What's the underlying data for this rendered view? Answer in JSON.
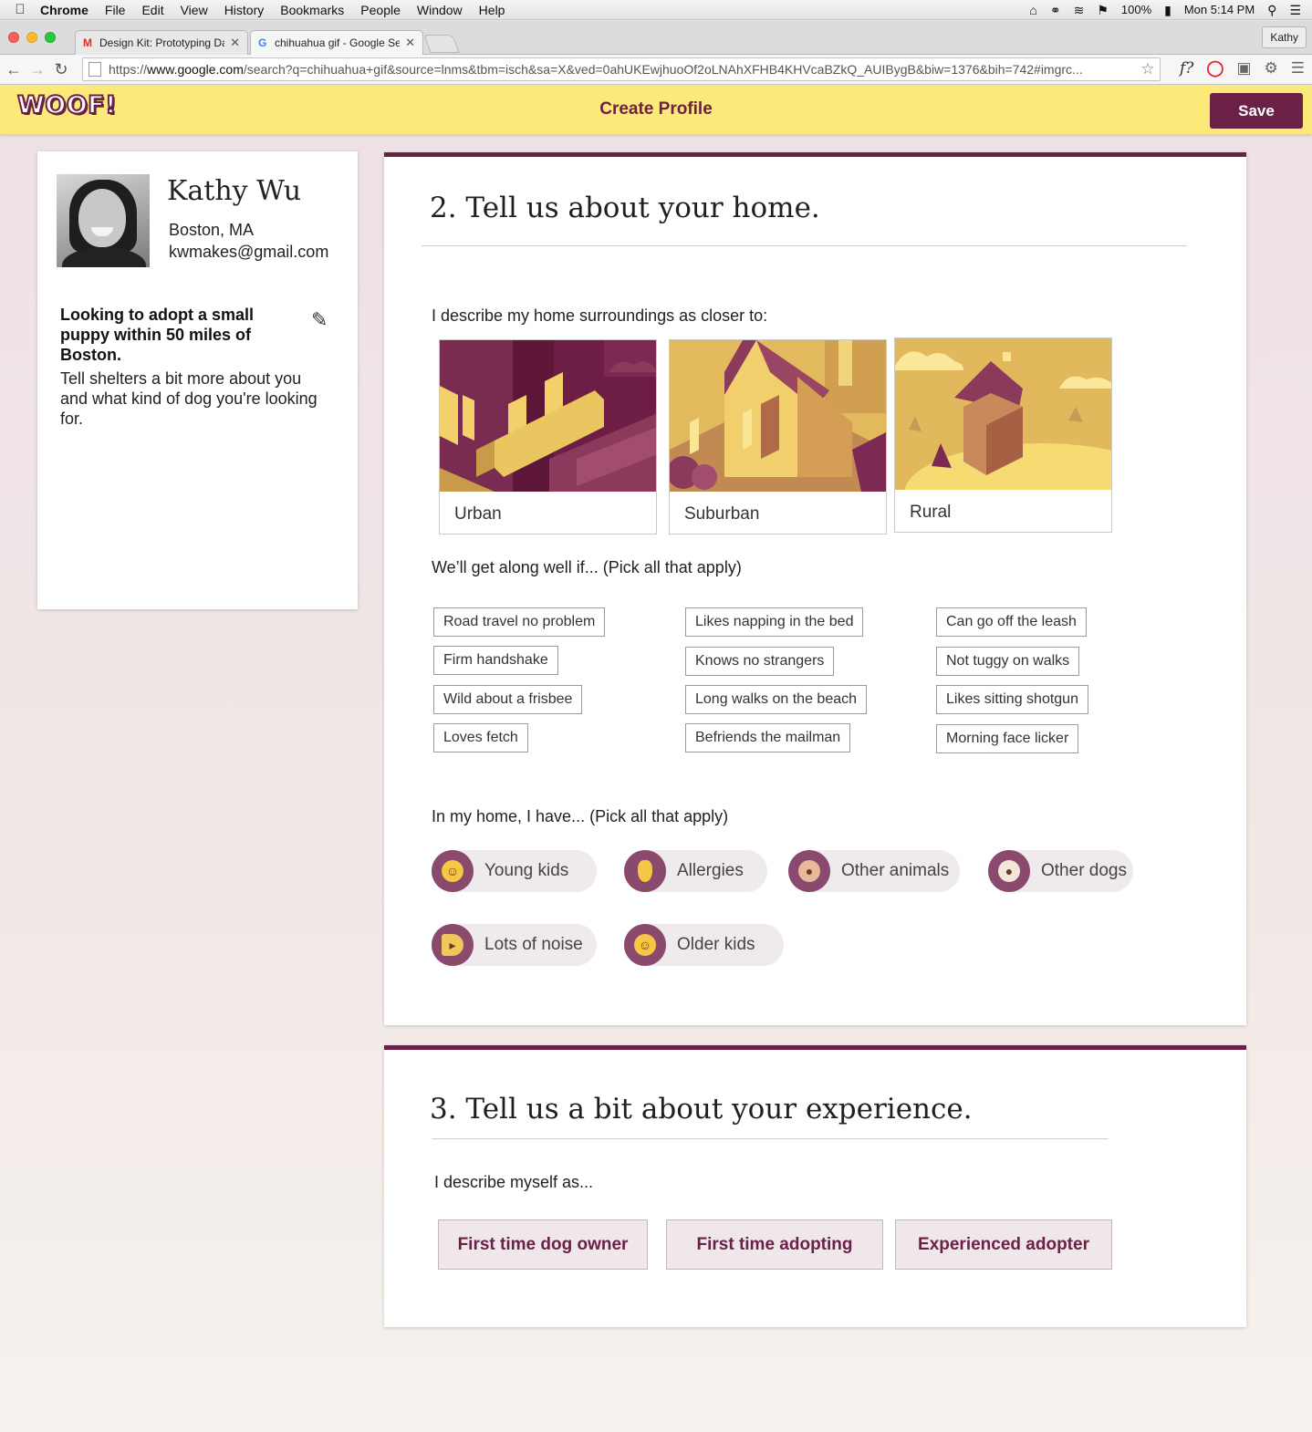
{
  "menubar": {
    "app": "Chrome",
    "items": [
      "File",
      "Edit",
      "View",
      "History",
      "Bookmarks",
      "People",
      "Window",
      "Help"
    ],
    "battery": "100%",
    "clock": "Mon 5:14 PM"
  },
  "browser": {
    "tabs": [
      {
        "favicon": "M",
        "title": "Design Kit: Prototyping Da"
      },
      {
        "favicon": "G",
        "title": "chihuahua gif - Google Se"
      }
    ],
    "profile": "Kathy",
    "url_prefix": "https://",
    "url_host": "www.google.com",
    "url_rest": "/search?q=chihuahua+gif&source=lnms&tbm=isch&sa=X&ved=0ahUKEwjhuoOf2oLNAhXFHB4KHVcaBZkQ_AUIBygB&biw=1376&bih=742#imgrc...",
    "ext_label": "f?"
  },
  "app": {
    "logo": "WOOF!",
    "title": "Create Profile",
    "save_label": "Save",
    "colors": {
      "brand": "#6b2146",
      "header": "#fde87a"
    }
  },
  "profile": {
    "name": "Kathy Wu",
    "location": "Boston, MA",
    "email": "kwmakes@gmail.com",
    "goal": "Looking to adopt a small puppy within 50 miles of Boston.",
    "description": "Tell shelters a bit more about you and what kind of dog you're looking for."
  },
  "home": {
    "title": "2. Tell us about your home.",
    "surroundings_question": "I describe my home surroundings as closer to:",
    "surroundings": [
      "Urban",
      "Suburban",
      "Rural"
    ],
    "traits_question": "We’ll get along well if... (Pick all that apply)",
    "traits": [
      [
        "Road travel no problem",
        "Firm handshake",
        "Wild about a frisbee",
        "Loves fetch"
      ],
      [
        "Likes napping in the bed",
        "Knows no strangers",
        "Long walks on the beach",
        "Befriends the mailman"
      ],
      [
        "Can go off the leash",
        "Not tuggy on walks",
        "Likes sitting shotgun",
        "Morning face licker"
      ]
    ],
    "household_question": "In my home, I have... (Pick all that apply)",
    "household": [
      {
        "label": "Young kids",
        "icon": "baby-icon"
      },
      {
        "label": "Allergies",
        "icon": "nose-icon"
      },
      {
        "label": "Other animals",
        "icon": "hamster-icon"
      },
      {
        "label": "Other dogs",
        "icon": "dog-icon"
      },
      {
        "label": "Lots of noise",
        "icon": "megaphone-icon"
      },
      {
        "label": "Older kids",
        "icon": "child-icon"
      }
    ]
  },
  "experience": {
    "title": "3. Tell us a bit about your experience.",
    "question": "I describe myself as...",
    "options": [
      "First time dog owner",
      "First time adopting",
      "Experienced adopter"
    ]
  }
}
